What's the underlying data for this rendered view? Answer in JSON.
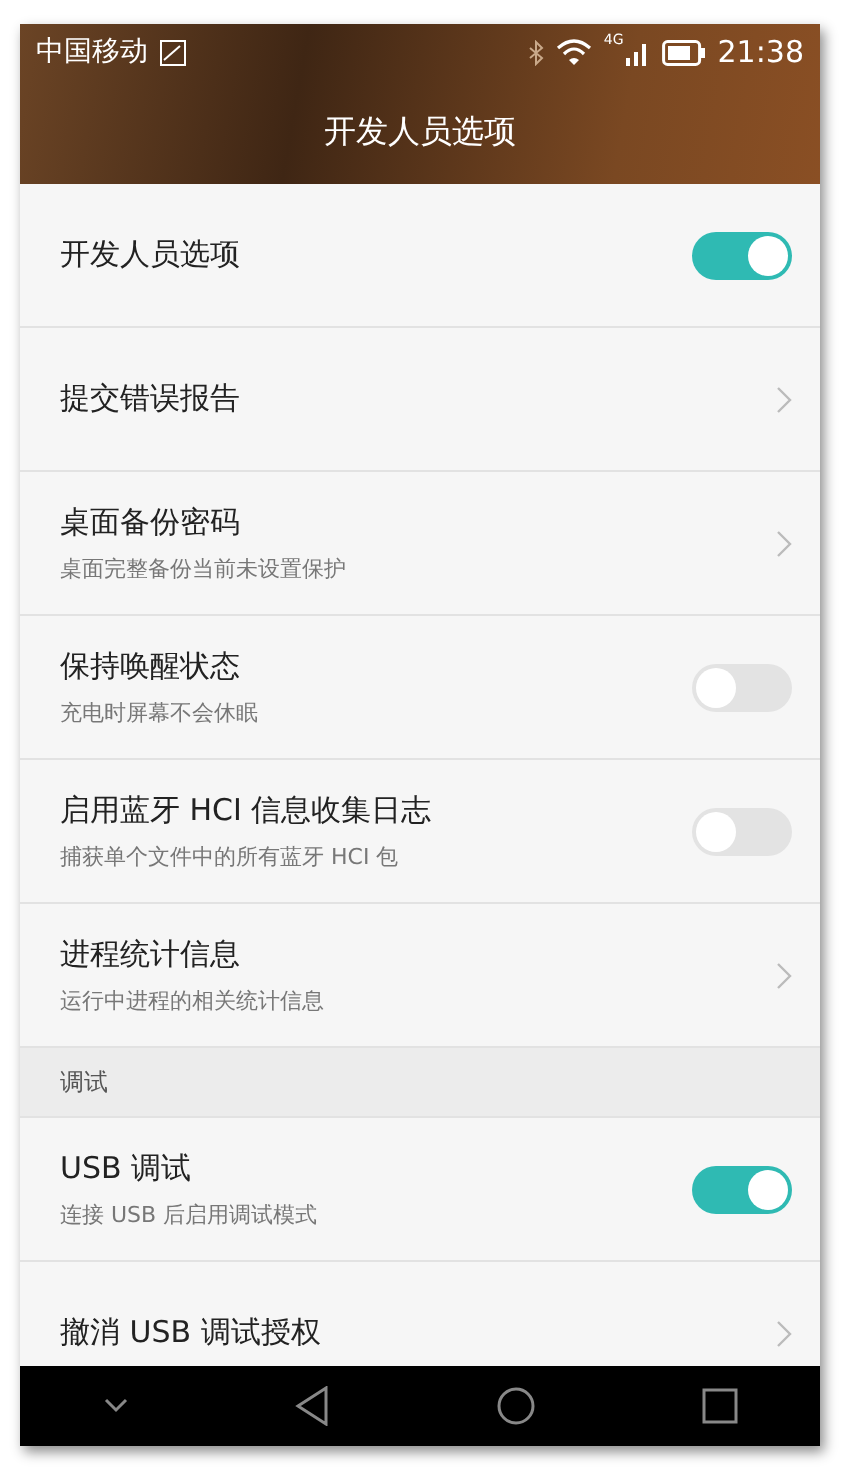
{
  "status_bar": {
    "carrier": "中国移动",
    "network": "4G",
    "time": "21:38"
  },
  "app_bar": {
    "title": "开发人员选项"
  },
  "items": [
    {
      "kind": "switch",
      "title": "开发人员选项",
      "on": true
    },
    {
      "kind": "chevron",
      "title": "提交错误报告"
    },
    {
      "kind": "chevron",
      "title": "桌面备份密码",
      "subtitle": "桌面完整备份当前未设置保护"
    },
    {
      "kind": "switch",
      "title": "保持唤醒状态",
      "subtitle": "充电时屏幕不会休眠",
      "on": false
    },
    {
      "kind": "switch",
      "title": "启用蓝牙 HCI 信息收集日志",
      "subtitle": "捕获单个文件中的所有蓝牙 HCI 包",
      "on": false
    },
    {
      "kind": "chevron",
      "title": "进程统计信息",
      "subtitle": "运行中进程的相关统计信息"
    },
    {
      "kind": "header",
      "title": "调试"
    },
    {
      "kind": "switch",
      "title": "USB 调试",
      "subtitle": "连接 USB 后启用调试模式",
      "on": true
    },
    {
      "kind": "chevron",
      "title": "撤消 USB 调试授权"
    }
  ]
}
